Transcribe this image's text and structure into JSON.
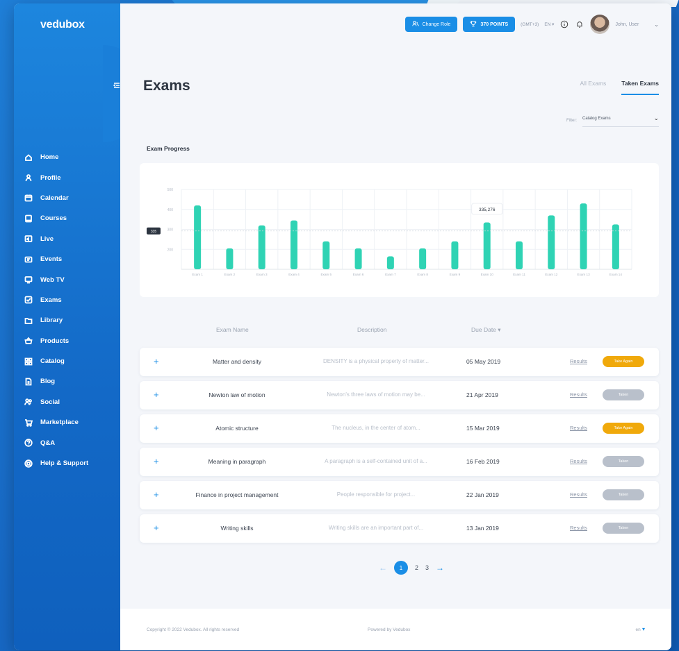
{
  "brand": {
    "logo": "vedubox"
  },
  "topbar": {
    "change_role": "Change Role",
    "points": "370 POINTS",
    "timezone": "(GMT+3)",
    "language": "EN",
    "user_name": "John, User"
  },
  "page": {
    "title": "Exams",
    "tabs": [
      {
        "label": "All Exams",
        "active": false
      },
      {
        "label": "Taken Exams",
        "active": true
      }
    ],
    "filter_label": "Filter:",
    "filter_value": "Catalog Exams",
    "section_label": "Exam Progress"
  },
  "sidebar": {
    "items": [
      {
        "label": "Home",
        "icon": "home-icon"
      },
      {
        "label": "Profile",
        "icon": "user-icon"
      },
      {
        "label": "Calendar",
        "icon": "calendar-icon"
      },
      {
        "label": "Courses",
        "icon": "book-icon"
      },
      {
        "label": "Live",
        "icon": "live-icon"
      },
      {
        "label": "Events",
        "icon": "ticket-icon"
      },
      {
        "label": "Web TV",
        "icon": "tv-icon"
      },
      {
        "label": "Exams",
        "icon": "checklist-icon"
      },
      {
        "label": "Library",
        "icon": "folder-icon"
      },
      {
        "label": "Products",
        "icon": "basket-icon"
      },
      {
        "label": "Catalog",
        "icon": "grid-icon"
      },
      {
        "label": "Blog",
        "icon": "document-icon"
      },
      {
        "label": "Social",
        "icon": "people-icon"
      },
      {
        "label": "Marketplace",
        "icon": "cart-icon"
      },
      {
        "label": "Q&A",
        "icon": "question-icon"
      },
      {
        "label": "Help & Support",
        "icon": "lifebuoy-icon"
      }
    ]
  },
  "chart_data": {
    "type": "bar",
    "categories": [
      "Exam 1",
      "Exam 2",
      "Exam 3",
      "Exam 4",
      "Exam 5",
      "Exam 6",
      "Exam 7",
      "Exam 8",
      "Exam 9",
      "Exam 10",
      "Exam 11",
      "Exam 12",
      "Exam 13",
      "Exam 14"
    ],
    "values": [
      420,
      205,
      320,
      345,
      240,
      205,
      165,
      205,
      240,
      335,
      240,
      370,
      430,
      325
    ],
    "y_ticks": [
      200,
      300,
      400,
      500
    ],
    "ylim": [
      100,
      500
    ],
    "tooltip": "335,276",
    "marker_label": "335",
    "bar_color": "#2fd3b4"
  },
  "table": {
    "headers": {
      "name": "Exam Name",
      "description": "Description",
      "due_date": "Due Date"
    },
    "rows": [
      {
        "name": "Matter and density",
        "description": "DENSITY is a physical property of matter...",
        "date": "05 May 2019",
        "results": "Results",
        "status": "Take Again",
        "kind": "again"
      },
      {
        "name": "Newton law of motion",
        "description": "Newton's three laws of motion may be...",
        "date": "21 Apr 2019",
        "results": "Results",
        "status": "Taken",
        "kind": "taken"
      },
      {
        "name": "Atomic structure",
        "description": "The nucleus, in the center of atom...",
        "date": "15 Mar 2019",
        "results": "Results",
        "status": "Take Again",
        "kind": "again"
      },
      {
        "name": "Meaning in paragraph",
        "description": "A paragraph is a self-contained unit of a...",
        "date": "16 Feb 2019",
        "results": "Results",
        "status": "Taken",
        "kind": "taken"
      },
      {
        "name": "Finance in project management",
        "description": "People responsible for project...",
        "date": "22 Jan 2019",
        "results": "Results",
        "status": "Taken",
        "kind": "taken"
      },
      {
        "name": "Writing skills",
        "description": "Writing skills are an important part of...",
        "date": "13 Jan 2019",
        "results": "Results",
        "status": "Taken",
        "kind": "taken"
      }
    ]
  },
  "pagination": {
    "pages": [
      "1",
      "2",
      "3"
    ],
    "current": "1"
  },
  "footer": {
    "copyright": "Copyright © 2022 Vedubox. All rights reserved",
    "powered": "Powered by Vedubox",
    "language": "en"
  },
  "colors": {
    "primary": "#1a8ee6",
    "sidebar": "#1369c7",
    "take_again": "#f0a90b",
    "taken": "#b9c0cb",
    "bar": "#2fd3b4"
  }
}
